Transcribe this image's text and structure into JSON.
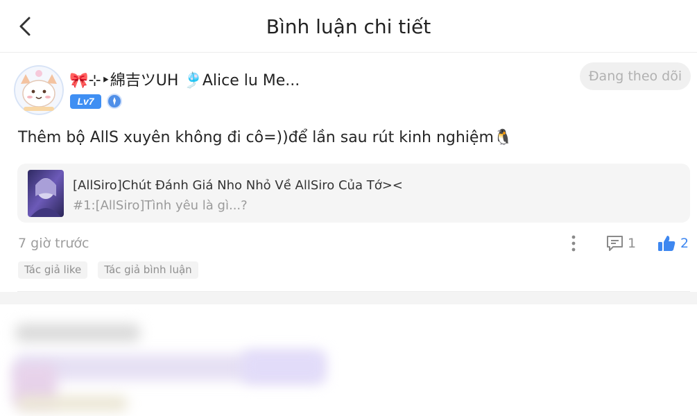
{
  "header": {
    "title": "Bình luận chi tiết",
    "back_icon": "chevron-left-icon"
  },
  "comment": {
    "username": "🎀⊹‣綿吉ツUH 🎐Alice lu Me...",
    "level": "Lv7",
    "follow_label": "Đang theo dõi",
    "text": "Thêm bộ AllS xuyên không đi cô=))để lần sau rút kinh nghiệm🐧",
    "post": {
      "title": "[AllSiro]Chút Đánh Giá Nho Nhỏ Về AllSiro Của Tớ><",
      "subtitle": "#1:[AllSiro]Tình yêu là gì...?"
    },
    "time": "7 giờ trước",
    "reply_count": "1",
    "like_count": "2",
    "tags": [
      "Tác giả like",
      "Tác giả bình luận"
    ]
  },
  "colors": {
    "accent": "#3e87f0",
    "muted_text": "#9d9d9d",
    "tag_bg": "#f3f3f3",
    "card_bg": "#f5f5f5"
  }
}
